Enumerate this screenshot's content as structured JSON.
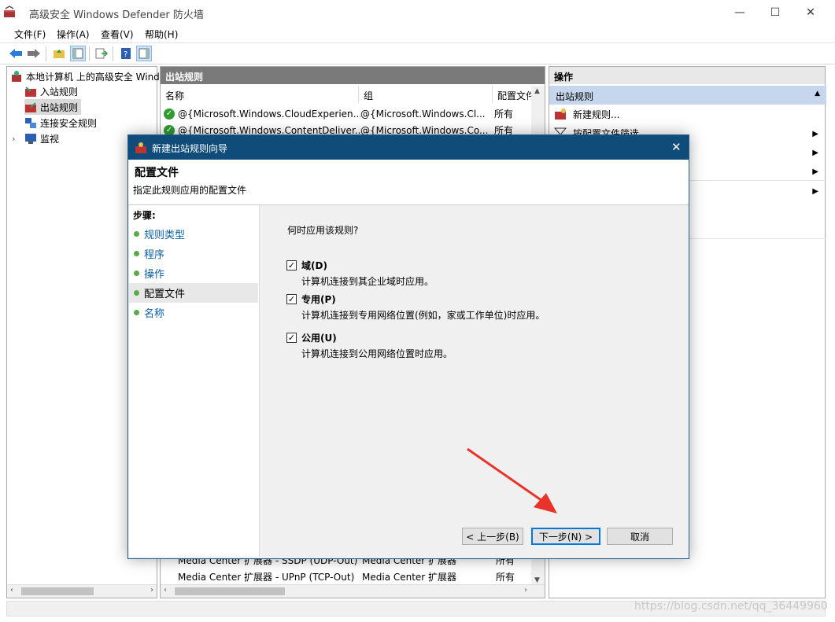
{
  "window": {
    "title": "高级安全 Windows Defender 防火墙",
    "minimize": "—",
    "maximize": "☐",
    "close": "✕"
  },
  "menu": [
    "文件(F)",
    "操作(A)",
    "查看(V)",
    "帮助(H)"
  ],
  "tree": {
    "root": "本地计算机 上的高级安全 Wind",
    "items": [
      "入站规则",
      "出站规则",
      "连接安全规则",
      "监视"
    ]
  },
  "middle": {
    "header": "出站规则",
    "columns": [
      "名称",
      "组",
      "配置文件"
    ],
    "rows_top": [
      {
        "name": "@{Microsoft.Windows.CloudExperien...",
        "group": "@{Microsoft.Windows.Cl...",
        "profile": "所有"
      },
      {
        "name": "@{Microsoft.Windows.ContentDeliver...",
        "group": "@{Microsoft.Windows.Co...",
        "profile": "所有"
      }
    ],
    "rows_bottom": [
      {
        "name": "Media Center 扩展器 - SSDP (UDP-Out)",
        "group": "Media Center 扩展器",
        "profile": "所有"
      },
      {
        "name": "Media Center 扩展器 - UPnP (TCP-Out)",
        "group": "Media Center 扩展器",
        "profile": "所有"
      }
    ]
  },
  "actions": {
    "header": "操作",
    "section": "出站规则",
    "items": [
      "新建规则...",
      "按配置文件筛选"
    ]
  },
  "dialog": {
    "title": "新建出站规则向导",
    "heading": "配置文件",
    "subheading": "指定此规则应用的配置文件",
    "steps_label": "步骤:",
    "steps": [
      "规则类型",
      "程序",
      "操作",
      "配置文件",
      "名称"
    ],
    "question": "何时应用该规则?",
    "options": [
      {
        "label": "域(D)",
        "desc": "计算机连接到其企业域时应用。",
        "checked": true
      },
      {
        "label": "专用(P)",
        "desc": "计算机连接到专用网络位置(例如，家或工作单位)时应用。",
        "checked": true
      },
      {
        "label": "公用(U)",
        "desc": "计算机连接到公用网络位置时应用。",
        "checked": true
      }
    ],
    "buttons": {
      "back": "< 上一步(B)",
      "next": "下一步(N) >",
      "cancel": "取消"
    }
  },
  "watermark": "https://blog.csdn.net/qq_36449960"
}
